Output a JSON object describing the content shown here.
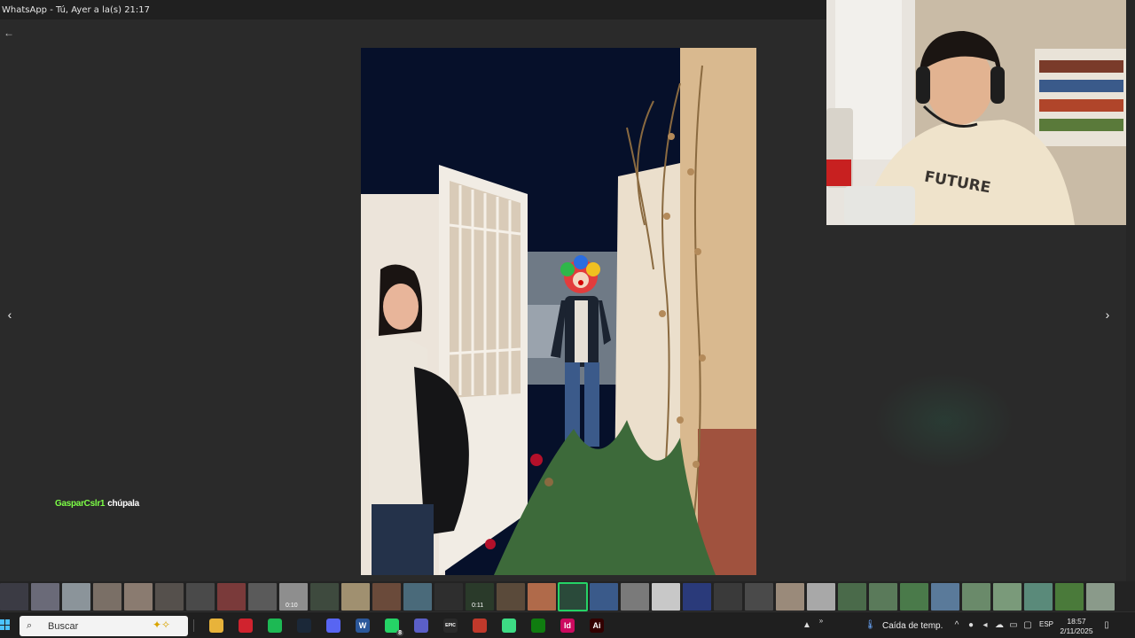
{
  "window": {
    "title": "WhatsApp - Tú, Ayer a la(s) 21:17"
  },
  "viewer": {
    "back_glyph": "←",
    "prev_glyph": "‹",
    "next_glyph": "›"
  },
  "chat_overlay": {
    "username": "GasparCslr1",
    "message": "chúpala"
  },
  "webcam": {
    "shirt_text": "FUTURE"
  },
  "thumbnails": {
    "items": [
      {
        "color": "#3b3b44"
      },
      {
        "color": "#6a6a78"
      },
      {
        "color": "#8b949a"
      },
      {
        "color": "#7a6f66"
      },
      {
        "color": "#8a7b70"
      },
      {
        "color": "#55504c"
      },
      {
        "color": "#4a4a4a"
      },
      {
        "color": "#7a3a3a"
      },
      {
        "color": "#5a5a5a"
      },
      {
        "color": "#8e8e8e",
        "duration": "0:10"
      },
      {
        "color": "#3e4a3e"
      },
      {
        "color": "#a09070"
      },
      {
        "color": "#6a4a3a"
      },
      {
        "color": "#4a6a7a"
      },
      {
        "color": "#2e2e2e"
      },
      {
        "color": "#2a3a2a",
        "duration": "0:11"
      },
      {
        "color": "#5a4a3a"
      },
      {
        "color": "#b06a4a"
      },
      {
        "color": "#2a4a3a",
        "active": true
      },
      {
        "color": "#3a5a8a"
      },
      {
        "color": "#7a7a7a"
      },
      {
        "color": "#c8c8c8"
      },
      {
        "color": "#2a3a7a"
      },
      {
        "color": "#3a3a3a"
      },
      {
        "color": "#4a4a4a"
      },
      {
        "color": "#9a8a7a"
      },
      {
        "color": "#a8a8a8"
      },
      {
        "color": "#4a6a4a"
      },
      {
        "color": "#5a7a5a"
      },
      {
        "color": "#4a7a4a"
      },
      {
        "color": "#5a7a9a"
      },
      {
        "color": "#6a8a6a"
      },
      {
        "color": "#7a9a7a"
      },
      {
        "color": "#5a8a7a"
      },
      {
        "color": "#4a7a3a"
      },
      {
        "color": "#8a9a8a"
      }
    ]
  },
  "taskbar": {
    "search_placeholder": "Buscar",
    "apps": [
      {
        "name": "file-explorer",
        "color": "#e8b33a",
        "label": ""
      },
      {
        "name": "opera",
        "color": "#d0232e",
        "label": ""
      },
      {
        "name": "spotify",
        "color": "#1db954",
        "label": ""
      },
      {
        "name": "steam",
        "color": "#1b2838",
        "label": ""
      },
      {
        "name": "discord",
        "color": "#5865f2",
        "label": ""
      },
      {
        "name": "word",
        "color": "#2b579a",
        "label": "W"
      },
      {
        "name": "whatsapp",
        "color": "#25d366",
        "label": "",
        "badge": "8"
      },
      {
        "name": "teams",
        "color": "#5b5fc7",
        "label": ""
      },
      {
        "name": "epic-games",
        "color": "#2a2a2a",
        "label": "EPIC"
      },
      {
        "name": "browser-red",
        "color": "#c0392b",
        "label": ""
      },
      {
        "name": "android-app",
        "color": "#3ddc84",
        "label": ""
      },
      {
        "name": "xbox",
        "color": "#107c10",
        "label": ""
      },
      {
        "name": "indesign",
        "color": "#cc0a5f",
        "label": "Id"
      },
      {
        "name": "illustrator",
        "color": "#330000",
        "label": "Ai"
      }
    ],
    "weather_text": "Caída de temp.",
    "language": "ESP",
    "time": "18:57",
    "date": "2/11/2025"
  },
  "colors": {
    "chat_username": "#7dff46",
    "whatsapp_green": "#25d366",
    "windows_blue": "#4cc2ff"
  }
}
